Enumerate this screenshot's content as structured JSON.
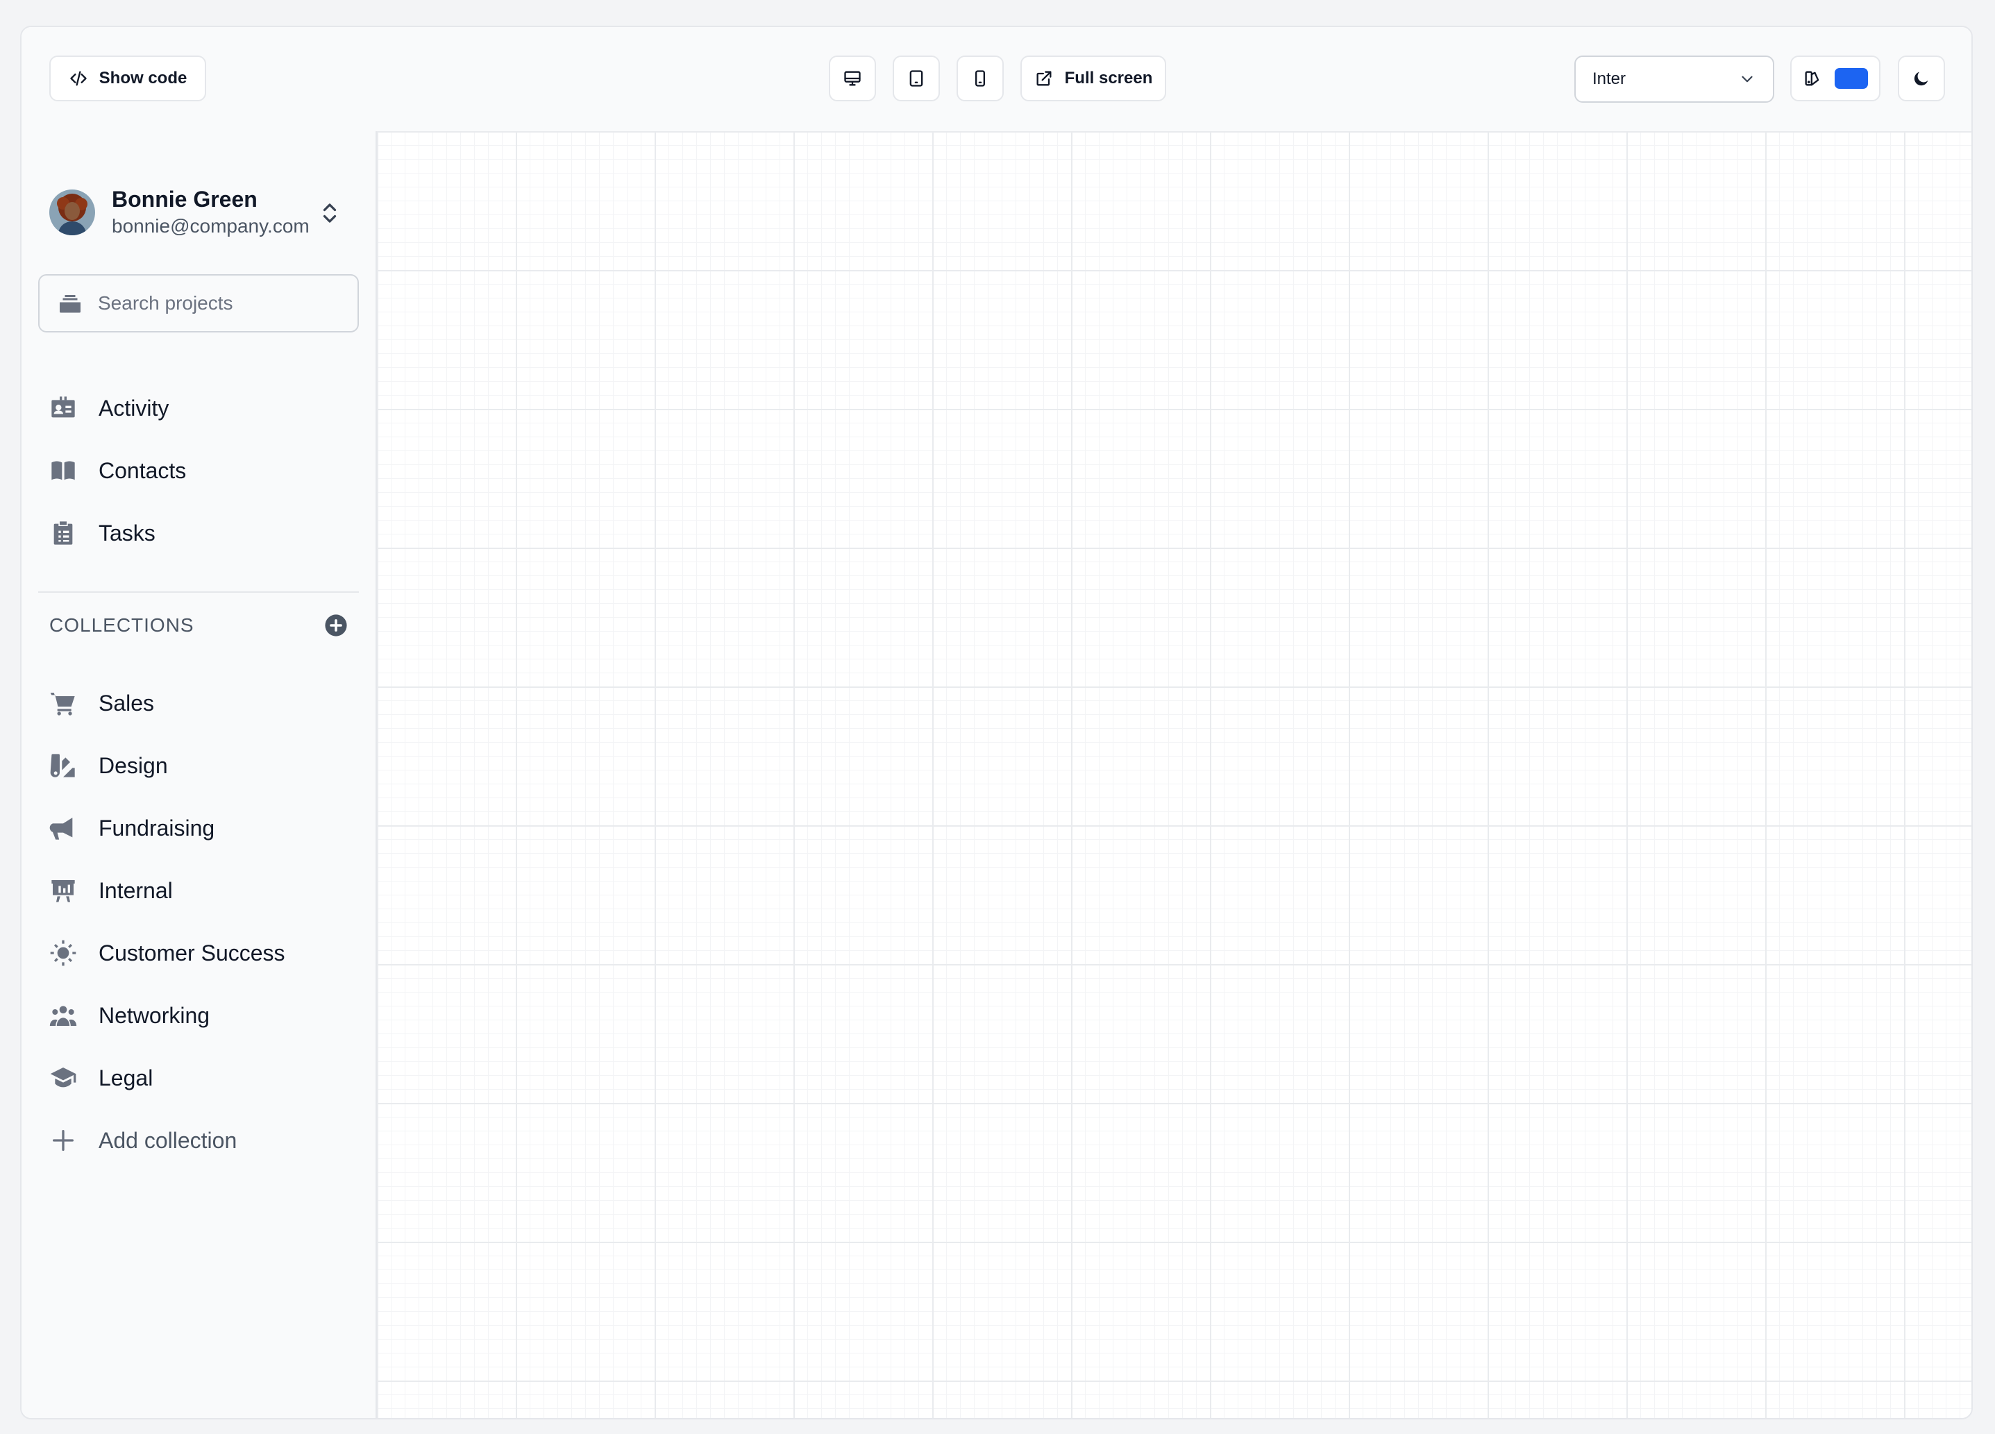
{
  "toolbar": {
    "show_code_label": "Show code",
    "view_buttons": [
      {
        "name": "desktop-view-button",
        "icon": "desktop-icon"
      },
      {
        "name": "tablet-view-button",
        "icon": "tablet-icon"
      },
      {
        "name": "mobile-view-button",
        "icon": "mobile-icon"
      }
    ],
    "fullscreen_label": "Full screen",
    "font_select_value": "Inter",
    "accent_color": "#1c64f2",
    "theme_icon": "moon-icon"
  },
  "sidebar": {
    "user": {
      "name": "Bonnie Green",
      "email": "bonnie@company.com"
    },
    "search": {
      "placeholder": "Search projects"
    },
    "nav": [
      {
        "label": "Activity",
        "icon": "id-badge-icon"
      },
      {
        "label": "Contacts",
        "icon": "book-open-icon"
      },
      {
        "label": "Tasks",
        "icon": "clipboard-list-icon"
      }
    ],
    "collections_title": "COLLECTIONS",
    "collections": [
      {
        "label": "Sales",
        "icon": "cart-icon"
      },
      {
        "label": "Design",
        "icon": "palette-icon"
      },
      {
        "label": "Fundraising",
        "icon": "megaphone-icon"
      },
      {
        "label": "Internal",
        "icon": "presentation-chart-icon"
      },
      {
        "label": "Customer Success",
        "icon": "lightbulb-icon"
      },
      {
        "label": "Networking",
        "icon": "users-group-icon"
      },
      {
        "label": "Legal",
        "icon": "graduation-cap-icon"
      }
    ],
    "add_collection_label": "Add collection"
  },
  "colors": {
    "icon_gray": "#6b7280",
    "text_dark": "#111827",
    "border": "#e5e7eb"
  }
}
